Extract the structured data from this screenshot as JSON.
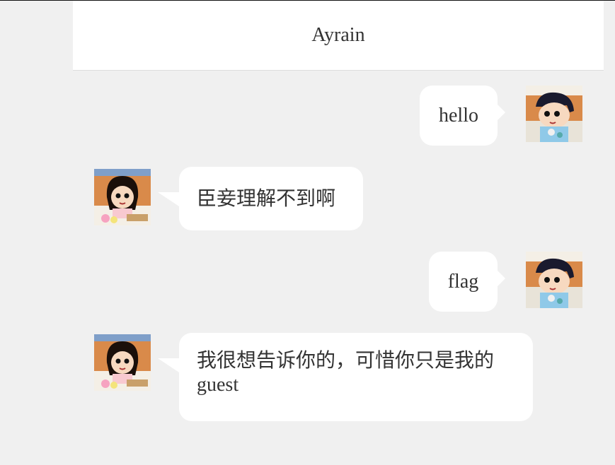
{
  "header": {
    "title": "Ayrain"
  },
  "messages": [
    {
      "side": "right",
      "text": "hello",
      "avatar": "boy-cartoon-avatar"
    },
    {
      "side": "left",
      "text": "臣妾理解不到啊",
      "avatar": "girl-cartoon-avatar"
    },
    {
      "side": "right",
      "text": "flag",
      "avatar": "boy-cartoon-avatar"
    },
    {
      "side": "left",
      "text_line1": "我很想告诉你的，可惜你只是我的",
      "text_line2": "guest",
      "avatar": "girl-cartoon-avatar"
    }
  ],
  "colors": {
    "background": "#f0f0f0",
    "header": "#ffffff",
    "bubble": "#ffffff",
    "text": "#333333"
  }
}
